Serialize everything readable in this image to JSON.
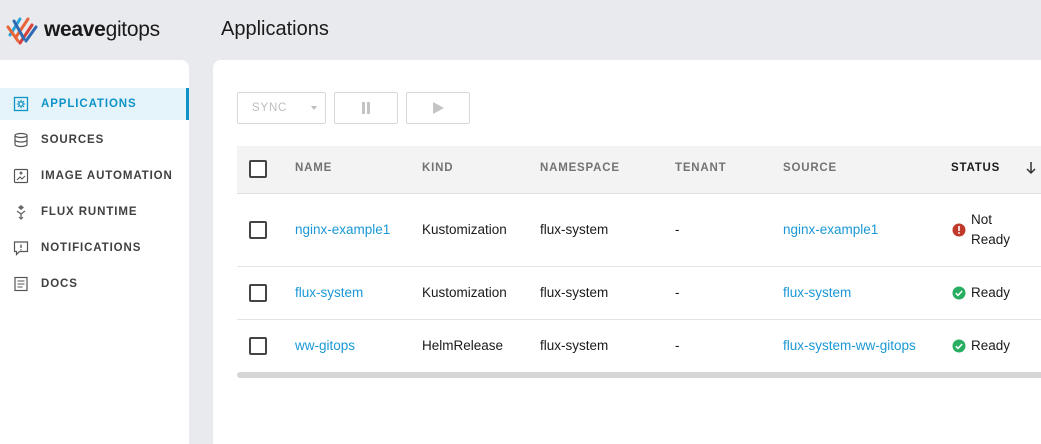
{
  "app": {
    "logo_bold": "weave",
    "logo_light": "gitops",
    "page_title": "Applications"
  },
  "sidebar": {
    "items": [
      {
        "label": "APPLICATIONS",
        "icon": "applications-icon",
        "active": true
      },
      {
        "label": "SOURCES",
        "icon": "sources-icon",
        "active": false
      },
      {
        "label": "IMAGE AUTOMATION",
        "icon": "image-automation-icon",
        "active": false
      },
      {
        "label": "FLUX RUNTIME",
        "icon": "flux-runtime-icon",
        "active": false
      },
      {
        "label": "NOTIFICATIONS",
        "icon": "notifications-icon",
        "active": false
      },
      {
        "label": "DOCS",
        "icon": "docs-icon",
        "active": false
      }
    ]
  },
  "toolbar": {
    "sync_label": "SYNC",
    "suspend_icon": "pause-icon",
    "resume_icon": "play-icon"
  },
  "table": {
    "headers": [
      "NAME",
      "KIND",
      "NAMESPACE",
      "TENANT",
      "SOURCE",
      "STATUS"
    ],
    "sorted_column": "STATUS",
    "rows": [
      {
        "name": "nginx-example1",
        "kind": "Kustomization",
        "namespace": "flux-system",
        "tenant": "-",
        "source": "nginx-example1",
        "status": "Not Ready",
        "status_type": "error"
      },
      {
        "name": "flux-system",
        "kind": "Kustomization",
        "namespace": "flux-system",
        "tenant": "-",
        "source": "flux-system",
        "status": "Ready",
        "status_type": "success"
      },
      {
        "name": "ww-gitops",
        "kind": "HelmRelease",
        "namespace": "flux-system",
        "tenant": "-",
        "source": "flux-system-ww-gitops",
        "status": "Ready",
        "status_type": "success"
      }
    ]
  },
  "colors": {
    "accent": "#0e93c8",
    "link": "#1a98d5",
    "success": "#27ae60",
    "error": "#c0392b",
    "background": "#e9eaee"
  }
}
